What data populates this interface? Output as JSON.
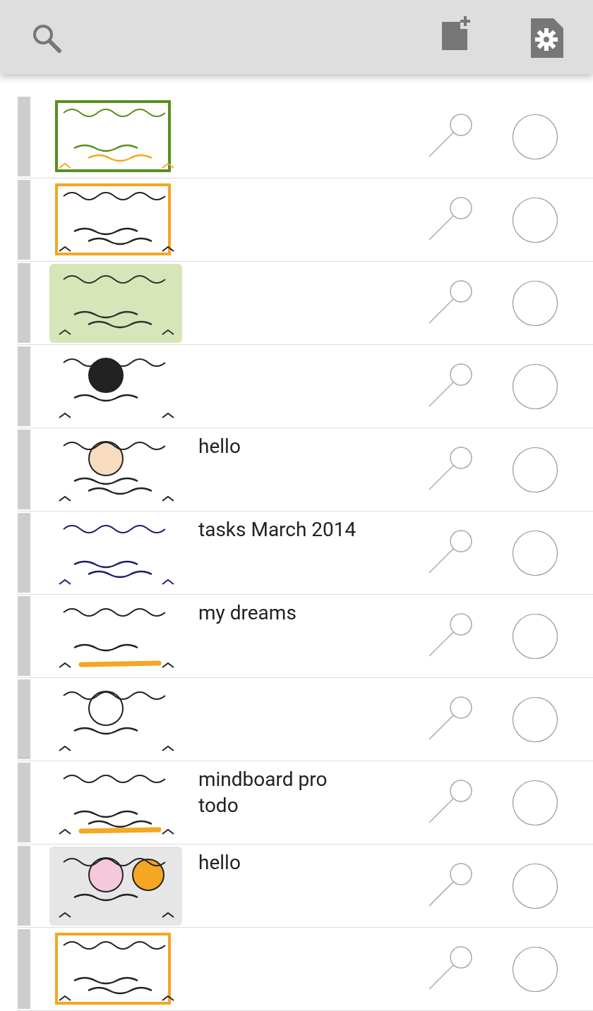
{
  "notes": [
    {
      "checked": false
    },
    {
      "checked": false
    },
    {
      "checked": false
    },
    {
      "checked": false
    },
    {
      "title": "hello",
      "checked": false
    },
    {
      "title": "tasks March 2014",
      "checked": false
    },
    {
      "title": "my dreams",
      "checked": false
    },
    {
      "checked": false
    },
    {
      "title": "mindboard pro\ntodo",
      "checked": false
    },
    {
      "title": "hello",
      "checked": false
    },
    {
      "checked": false
    }
  ]
}
